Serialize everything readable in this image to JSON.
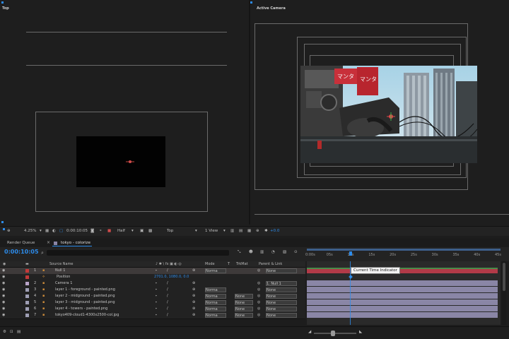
{
  "views": {
    "left_label": "Top",
    "right_label": "Active Camera"
  },
  "viewer_toolbar": {
    "zoom": "4.25%",
    "timecode": "0:00:10:05",
    "resolution": "Half",
    "view": "Top",
    "views_layout": "1 View",
    "exposure": "+0.0"
  },
  "panel_tabs": {
    "render_queue": "Render Queue",
    "comp_tab": "tokyo - colorize"
  },
  "timeline": {
    "current_time": "0:00:10:05",
    "search_placeholder": "",
    "ruler_ticks": [
      "0:00s",
      "05s",
      "10s",
      "15s",
      "20s",
      "25s",
      "30s",
      "35s",
      "40s",
      "45s"
    ],
    "tooltip": "Current Time Indicator",
    "columns": {
      "source_name": "Source Name",
      "mode": "Mode",
      "trkmat": "TrkMat",
      "parent": "Parent & Link"
    },
    "layers": [
      {
        "num": "1",
        "name": "Null 1",
        "mode": "Norma",
        "trkmat": "",
        "parent": "None",
        "color": "#c43a3a"
      },
      {
        "num": "",
        "name": "Position",
        "mode": "",
        "trkmat": "",
        "parent": "",
        "value": "2701.0, 1080.0, 0.0",
        "color": "#c43a3a"
      },
      {
        "num": "2",
        "name": "Camera 1",
        "mode": "",
        "trkmat": "",
        "parent": "1. Null 1",
        "color": "#b8a4c8"
      },
      {
        "num": "3",
        "name": "layer 1 - foreground - painted.png",
        "mode": "Norma",
        "trkmat": "",
        "parent": "None",
        "color": "#9e9eb4"
      },
      {
        "num": "4",
        "name": "layer 2 - midground - painted.png",
        "mode": "Norma",
        "trkmat": "None",
        "parent": "None",
        "color": "#9e9eb4"
      },
      {
        "num": "5",
        "name": "layer 3 - midground - painted.png",
        "mode": "Norma",
        "trkmat": "None",
        "parent": "None",
        "color": "#9e9eb4"
      },
      {
        "num": "6",
        "name": "layer 4 - towers - painted.png",
        "mode": "Norma",
        "trkmat": "None",
        "parent": "None",
        "color": "#9e9eb4"
      },
      {
        "num": "7",
        "name": "tokyo409-cloud1-4300x2500-col.jpg",
        "mode": "Norma",
        "trkmat": "None",
        "parent": "None",
        "color": "#9e9eb4"
      }
    ]
  },
  "poster_text": {
    "sign1": "マンタ",
    "sign2": "マンタ"
  },
  "colors": {
    "accent_blue": "#2d8ceb",
    "null_track": "#b23a48",
    "camera_track": "#4a8c4a",
    "layer_track": "#8a86a6"
  }
}
